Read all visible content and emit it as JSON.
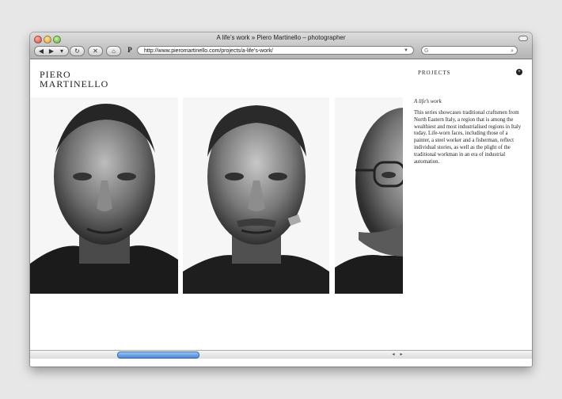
{
  "window": {
    "title": "A life’s work » Piero Martinello – photographer"
  },
  "toolbar": {
    "back_glyph": "◀",
    "forward_glyph": "▶",
    "menu_glyph": "▾",
    "reload_glyph": "↻",
    "stop_glyph": "✕",
    "home_glyph": "⌂",
    "site_icon": "P",
    "url": "http://www.pieromartinello.com/projects/a-life’s-work/",
    "url_arrow": "▼",
    "search_icon": "G",
    "magnifier": "⌕"
  },
  "site": {
    "logo_line1": "PIERO",
    "logo_line2": "MARTINELLO",
    "nav_projects": "PROJECTS",
    "toggle_glyph": "+"
  },
  "caption": {
    "title": "A life’s work",
    "text": "This series showcases traditional craftsmen from North Eastern Italy, a region that is among the wealthiest and most industrialised regions in Italy today. Life-worn faces, including those of a painter, a steel worker and a fisherman, reflect individual stories, as well as the plight of the traditional workman in an era of industrial automation."
  },
  "scrollbar": {
    "left_glyph": "◂",
    "right_glyph": "▸"
  },
  "colors": {
    "page_background": "#e7e7e7",
    "text": "#222222",
    "scroll_thumb": "#4a86d6"
  }
}
